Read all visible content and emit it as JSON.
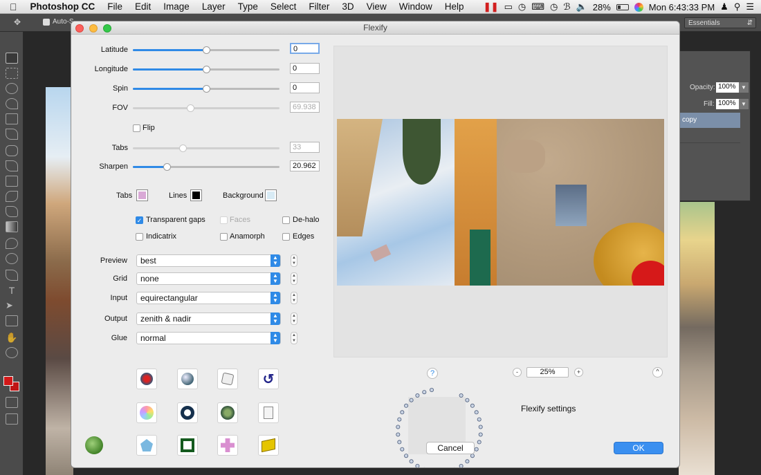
{
  "menubar": {
    "app": "Photoshop CC",
    "items": [
      "File",
      "Edit",
      "Image",
      "Layer",
      "Type",
      "Select",
      "Filter",
      "3D",
      "View",
      "Window",
      "Help"
    ],
    "battery": "28%",
    "clock": "Mon 6:43:33 PM"
  },
  "ps": {
    "options_label": "Auto-S",
    "workspace": "Essentials",
    "opacity_label": "Opacity:",
    "opacity_value": "100%",
    "fill_label": "Fill:",
    "fill_value": "100%",
    "layer_name": "copy"
  },
  "dialog": {
    "title": "Flexify",
    "sliders": [
      {
        "label": "Latitude",
        "value": "0",
        "level": 0.5,
        "enabled": true
      },
      {
        "label": "Longitude",
        "value": "0",
        "level": 0.5,
        "enabled": true
      },
      {
        "label": "Spin",
        "value": "0",
        "level": 0.5,
        "enabled": true
      },
      {
        "label": "FOV",
        "value": "69.938",
        "level": 0.39,
        "enabled": false
      },
      {
        "label": "Tabs",
        "value": "33",
        "level": 0.34,
        "enabled": false
      },
      {
        "label": "Sharpen",
        "value": "20.962",
        "level": 0.23,
        "enabled": true
      }
    ],
    "flip_label": "Flip",
    "colors": {
      "tabs_label": "Tabs",
      "tabs_color": "#d9a9d6",
      "lines_label": "Lines",
      "lines_color": "#000000",
      "background_label": "Background",
      "background_color": "#d8ebf5"
    },
    "checks": {
      "transparent_gaps": "Transparent gaps",
      "faces": "Faces",
      "dehalo": "De-halo",
      "indicatrix": "Indicatrix",
      "anamorph": "Anamorph",
      "edges": "Edges"
    },
    "selects": [
      {
        "label": "Preview",
        "value": "best"
      },
      {
        "label": "Grid",
        "value": "none"
      },
      {
        "label": "Input",
        "value": "equirectangular"
      },
      {
        "label": "Output",
        "value": "zenith & nadir"
      },
      {
        "label": "Glue",
        "value": "normal"
      }
    ],
    "help": "?",
    "zoom_minus": "-",
    "zoom": "25%",
    "zoom_plus": "+",
    "collapse": "^",
    "settings": "Flexify settings",
    "cancel": "Cancel",
    "ok": "OK"
  }
}
